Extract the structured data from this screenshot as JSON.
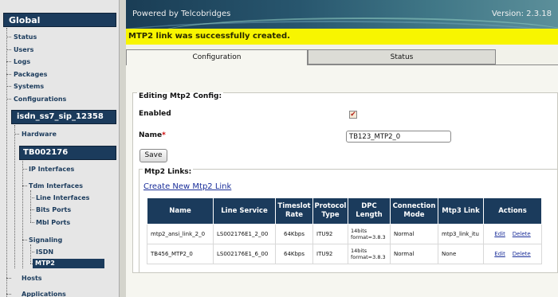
{
  "header": {
    "powered_by": "Powered by Telcobridges",
    "version": "Version: 2.3.18"
  },
  "banner": {
    "message": "MTP2 link was successfully created."
  },
  "sidebar": {
    "global_title": "Global",
    "global_items": [
      "Status",
      "Users",
      "Logs",
      "Packages",
      "Systems",
      "Configurations"
    ],
    "config_title": "isdn_ss7_sip_12358",
    "hardware": "Hardware",
    "device_title": "TB002176",
    "ip_interfaces": "IP Interfaces",
    "tdm_interfaces": "Tdm Interfaces",
    "tdm_items": [
      "Line Interfaces",
      "Bits Ports",
      "Mbl Ports"
    ],
    "signaling": "Signaling",
    "signaling_items": [
      "ISDN",
      "MTP2"
    ],
    "hosts": "Hosts",
    "applications": "Applications"
  },
  "tabs": {
    "configuration": "Configuration",
    "status": "Status"
  },
  "form": {
    "legend": "Editing Mtp2 Config:",
    "enabled_label": "Enabled",
    "enabled_checked": true,
    "checkmark": "✔",
    "name_label": "Name",
    "required_mark": "*",
    "name_value": "TB123_MTP2_0",
    "save_label": "Save"
  },
  "links": {
    "legend": "Mtp2 Links:",
    "create_label": "Create New Mtp2 Link",
    "columns": [
      "Name",
      "Line Service",
      "Timeslot Rate",
      "Protocol Type",
      "DPC Length",
      "Connection Mode",
      "Mtp3 Link",
      "Actions"
    ],
    "rows": [
      {
        "name": "mtp2_ansi_link_2_0",
        "line_service": "LS002176E1_2_00",
        "rate": "64Kbps",
        "protocol": "ITU92",
        "dpc": "14bits format=3.8.3",
        "mode": "Normal",
        "mtp3": "mtp3_link_itu",
        "edit": "Edit",
        "delete": "Delete"
      },
      {
        "name": "TB456_MTP2_0",
        "line_service": "LS002176E1_6_00",
        "rate": "64Kbps",
        "protocol": "ITU92",
        "dpc": "14bits format=3.8.3",
        "mode": "Normal",
        "mtp3": "None",
        "edit": "Edit",
        "delete": "Delete"
      }
    ]
  },
  "colors": {
    "nav_dark": "#1b3b5c",
    "banner": "#f8f500",
    "link": "#1b2f9a"
  }
}
